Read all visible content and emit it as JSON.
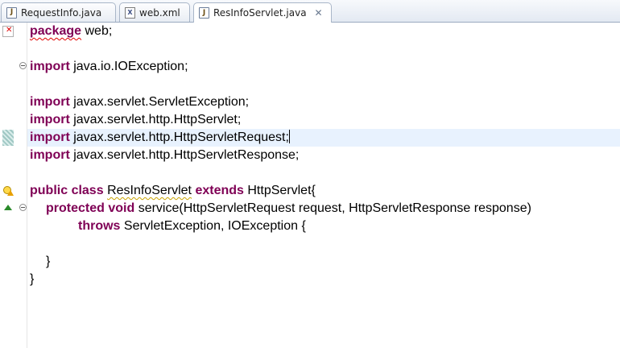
{
  "tabs": [
    {
      "label": "RequestInfo.java",
      "icon": "java-file-icon",
      "active": false
    },
    {
      "label": "web.xml",
      "icon": "xml-file-icon",
      "active": false
    },
    {
      "label": "ResInfoServlet.java",
      "icon": "java-file-icon",
      "active": true
    }
  ],
  "icons": {
    "java_glyph": "J",
    "xml_glyph": "X",
    "close_glyph": "✕"
  },
  "code": {
    "l1": {
      "kw": "package",
      "rest": " web;"
    },
    "l3": {
      "kw": "import",
      "rest": " java.io.IOException;"
    },
    "l5": {
      "kw": "import",
      "rest": " javax.servlet.ServletException;"
    },
    "l6": {
      "kw": "import",
      "rest": " javax.servlet.http.HttpServlet;"
    },
    "l7": {
      "kw": "import",
      "rest": " javax.servlet.http.HttpServletRequest;"
    },
    "l8": {
      "kw": "import",
      "rest": " javax.servlet.http.HttpServletResponse;"
    },
    "l10": {
      "kw1": "public",
      "kw2": "class",
      "name": "ResInfoServlet",
      "kw3": "extends",
      "rest": " HttpServlet{"
    },
    "l11": {
      "kw1": "protected",
      "kw2": "void",
      "rest": " service(HttpServletRequest request, HttpServletResponse response)"
    },
    "l12": {
      "kw": "throws",
      "rest": " ServletException, IOException {"
    },
    "l14": {
      "rest": "}"
    },
    "l15": {
      "rest": "}"
    }
  },
  "colors": {
    "keyword": "#7f0055",
    "current_line": "#e8f2fe",
    "tab_border": "#a9b6c8"
  }
}
